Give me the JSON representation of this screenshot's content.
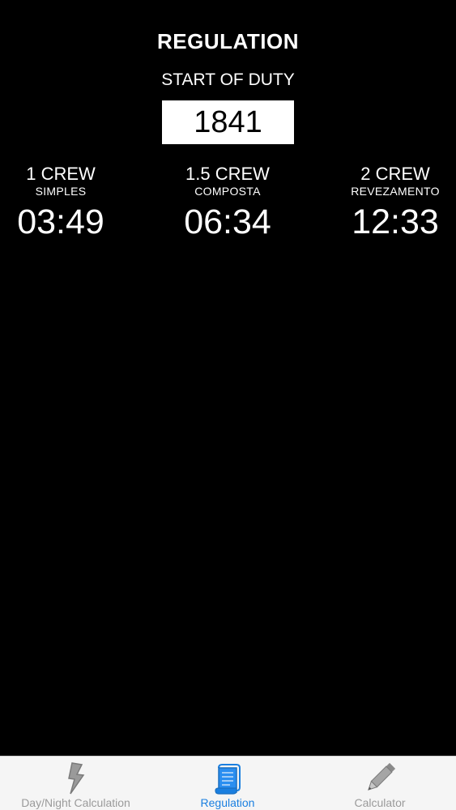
{
  "header": {
    "title": "REGULATION",
    "subtitle": "START OF DUTY"
  },
  "start_of_duty": {
    "value": "1841"
  },
  "crews": [
    {
      "name": "1 CREW",
      "sub": "SIMPLES",
      "time": "03:49"
    },
    {
      "name": "1.5 CREW",
      "sub": "COMPOSTA",
      "time": "06:34"
    },
    {
      "name": "2 CREW",
      "sub": "REVEZAMENTO",
      "time": "12:33"
    }
  ],
  "tabbar": {
    "items": [
      {
        "label": "Day/Night Calculation",
        "icon": "lightning-icon",
        "active": false
      },
      {
        "label": "Regulation",
        "icon": "scroll-icon",
        "active": true
      },
      {
        "label": "Calculator",
        "icon": "pencil-icon",
        "active": false
      }
    ]
  },
  "colors": {
    "background": "#000000",
    "text": "#ffffff",
    "tab_active": "#1a7fe0",
    "tab_inactive": "#9a9a9a",
    "tabbar_bg": "#f5f5f5"
  }
}
